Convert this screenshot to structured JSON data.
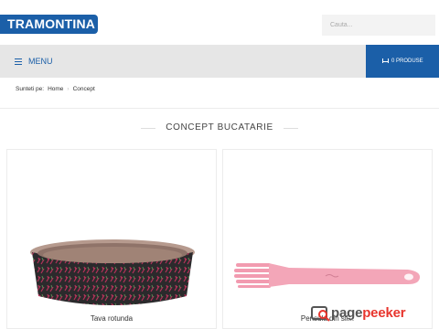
{
  "header": {
    "logo_text": "TRAMONTINA",
    "search_placeholder": "Cauta..."
  },
  "nav": {
    "menu_label": "MENU",
    "cart_label": "0 PRODUSE"
  },
  "breadcrumb": {
    "prefix": "Sunteti pe:",
    "items": [
      "Home",
      "Concept"
    ]
  },
  "page": {
    "title": "CONCEPT BUCATARIE"
  },
  "products": [
    {
      "name": "Tava rotunda"
    },
    {
      "name": "Pensula din sil..."
    }
  ],
  "watermark": {
    "brand_main": "page",
    "brand_accent": "peeker"
  },
  "colors": {
    "brand_blue": "#1b5fa8",
    "nav_bg": "#e6e6e6",
    "brush_pink": "#f3a6b8",
    "watermark_red": "#e8352d"
  }
}
